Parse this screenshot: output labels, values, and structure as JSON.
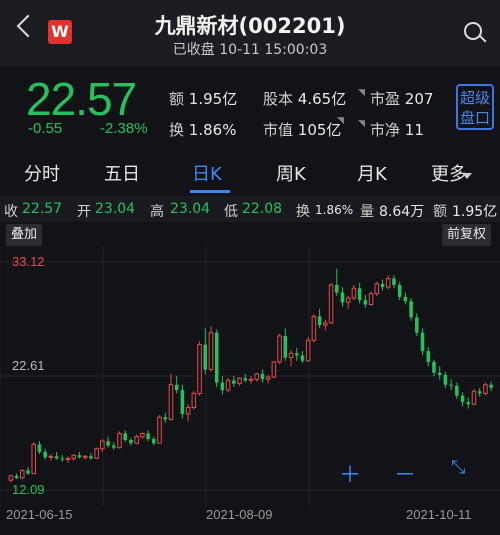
{
  "header": {
    "logo_text": "W",
    "title": "九鼎新材(002201)",
    "status": "已收盘 10-11 15:00:03",
    "back_icon": "chevron-left-icon",
    "search_icon": "search-icon"
  },
  "quote": {
    "price": "22.57",
    "change": "-0.55",
    "change_pct": "-2.38%",
    "amount_label": "额",
    "amount": "1.95亿",
    "turnover_label": "换",
    "turnover": "1.86%",
    "shares_label": "股本",
    "shares": "4.65亿",
    "mktcap_label": "市值",
    "mktcap": "105亿",
    "pe_label": "市盈",
    "pe": "207",
    "pb_label": "市净",
    "pb": "11",
    "super_btn_line1": "超级",
    "super_btn_line2": "盘口"
  },
  "tabs": [
    "分时",
    "五日",
    "日K",
    "周K",
    "月K",
    "更多"
  ],
  "active_tab": "日K",
  "ohlc": {
    "close_label": "收",
    "close": "22.57",
    "open_label": "开",
    "open": "23.04",
    "high_label": "高",
    "high": "23.04",
    "low_label": "低",
    "low": "22.08",
    "turn_label": "换",
    "turn": "1.86%",
    "vol_label": "量",
    "vol": "8.64万",
    "amt_label": "额",
    "amt": "1.95亿"
  },
  "chart_buttons": {
    "overlay": "叠加",
    "adjust": "前复权"
  },
  "zoom_icons": [
    "zoom-in-icon",
    "zoom-out-icon",
    "fullscreen-icon"
  ],
  "colors": {
    "up": "#e74a4a",
    "down": "#26c15e",
    "accent": "#3f87f5",
    "background": "#121317"
  },
  "chart_data": {
    "type": "candlestick",
    "y_max_label": "33.12",
    "y_mid_label": "22.61",
    "y_min_label": "12.09",
    "ylim": [
      12.09,
      33.12
    ],
    "x_labels": [
      "2021-06-15",
      "2021-08-09",
      "2021-10-11"
    ],
    "ohlc": [
      [
        13.0,
        13.5,
        12.8,
        13.4
      ],
      [
        13.4,
        13.6,
        13.1,
        13.2
      ],
      [
        13.2,
        14.0,
        13.1,
        13.9
      ],
      [
        13.9,
        14.2,
        13.5,
        13.6
      ],
      [
        13.6,
        16.5,
        13.6,
        16.3
      ],
      [
        16.3,
        16.6,
        15.4,
        15.6
      ],
      [
        15.6,
        15.9,
        14.9,
        15.1
      ],
      [
        15.1,
        15.4,
        14.8,
        15.2
      ],
      [
        15.2,
        15.6,
        14.9,
        15.0
      ],
      [
        15.0,
        15.3,
        14.7,
        14.9
      ],
      [
        14.9,
        15.2,
        14.6,
        15.0
      ],
      [
        15.0,
        15.4,
        14.8,
        15.3
      ],
      [
        15.3,
        15.6,
        15.0,
        15.1
      ],
      [
        15.1,
        15.3,
        14.9,
        15.2
      ],
      [
        15.2,
        15.5,
        14.9,
        15.0
      ],
      [
        15.0,
        16.0,
        15.0,
        15.9
      ],
      [
        15.9,
        16.8,
        15.6,
        16.6
      ],
      [
        16.6,
        17.0,
        16.0,
        16.2
      ],
      [
        16.2,
        16.5,
        15.8,
        16.0
      ],
      [
        16.0,
        17.5,
        15.9,
        17.3
      ],
      [
        17.3,
        17.6,
        16.5,
        16.7
      ],
      [
        16.7,
        16.9,
        16.2,
        16.4
      ],
      [
        16.4,
        17.2,
        16.3,
        17.0
      ],
      [
        17.0,
        17.4,
        16.8,
        17.3
      ],
      [
        17.3,
        17.6,
        16.6,
        16.8
      ],
      [
        16.8,
        17.0,
        16.2,
        16.4
      ],
      [
        16.4,
        19.0,
        16.4,
        18.8
      ],
      [
        18.8,
        19.2,
        18.3,
        18.6
      ],
      [
        18.6,
        22.8,
        18.5,
        21.8
      ],
      [
        21.8,
        22.6,
        21.0,
        21.3
      ],
      [
        21.3,
        21.8,
        18.7,
        19.1
      ],
      [
        19.1,
        20.0,
        18.4,
        19.7
      ],
      [
        19.7,
        21.2,
        19.5,
        21.0
      ],
      [
        21.0,
        25.8,
        20.8,
        25.5
      ],
      [
        25.5,
        27.0,
        22.8,
        23.2
      ],
      [
        23.2,
        27.2,
        23.0,
        26.6
      ],
      [
        26.6,
        26.9,
        21.6,
        22.0
      ],
      [
        22.0,
        22.6,
        20.9,
        21.3
      ],
      [
        21.3,
        22.4,
        21.1,
        22.2
      ],
      [
        22.2,
        22.6,
        21.6,
        21.9
      ],
      [
        21.9,
        22.5,
        21.7,
        22.4
      ],
      [
        22.4,
        22.8,
        22.0,
        22.2
      ],
      [
        22.2,
        22.6,
        21.9,
        22.3
      ],
      [
        22.3,
        22.9,
        22.1,
        22.8
      ],
      [
        22.8,
        23.2,
        22.0,
        22.3
      ],
      [
        22.3,
        22.7,
        21.9,
        22.5
      ],
      [
        22.5,
        24.0,
        22.4,
        23.9
      ],
      [
        23.9,
        26.5,
        23.7,
        26.3
      ],
      [
        26.3,
        27.0,
        24.0,
        24.3
      ],
      [
        24.3,
        25.0,
        23.5,
        24.7
      ],
      [
        24.7,
        25.2,
        24.0,
        24.5
      ],
      [
        24.5,
        24.9,
        23.8,
        24.0
      ],
      [
        24.0,
        26.2,
        23.9,
        25.9
      ],
      [
        25.9,
        28.3,
        25.7,
        28.1
      ],
      [
        28.1,
        28.8,
        27.0,
        27.3
      ],
      [
        27.3,
        27.8,
        26.8,
        27.5
      ],
      [
        27.5,
        31.2,
        27.4,
        31.0
      ],
      [
        31.0,
        32.5,
        30.0,
        30.3
      ],
      [
        30.3,
        30.8,
        29.0,
        29.4
      ],
      [
        29.4,
        30.0,
        28.8,
        29.8
      ],
      [
        29.8,
        31.0,
        29.6,
        30.7
      ],
      [
        30.7,
        31.2,
        29.3,
        29.6
      ],
      [
        29.6,
        30.1,
        28.9,
        29.2
      ],
      [
        29.2,
        30.4,
        29.1,
        30.2
      ],
      [
        30.2,
        31.3,
        30.0,
        31.1
      ],
      [
        31.1,
        31.5,
        30.5,
        30.8
      ],
      [
        30.8,
        31.9,
        30.6,
        31.6
      ],
      [
        31.6,
        31.9,
        30.7,
        31.0
      ],
      [
        31.0,
        31.3,
        29.6,
        29.9
      ],
      [
        29.9,
        30.3,
        29.2,
        29.5
      ],
      [
        29.5,
        29.8,
        27.7,
        28.0
      ],
      [
        28.0,
        28.4,
        26.3,
        26.6
      ],
      [
        26.6,
        27.0,
        24.5,
        24.9
      ],
      [
        24.9,
        25.3,
        23.5,
        23.9
      ],
      [
        23.9,
        24.1,
        22.6,
        22.9
      ],
      [
        22.9,
        23.5,
        22.3,
        22.7
      ],
      [
        22.7,
        23.0,
        21.5,
        21.8
      ],
      [
        21.8,
        22.3,
        21.3,
        21.7
      ],
      [
        21.7,
        22.0,
        20.5,
        20.8
      ],
      [
        20.8,
        21.1,
        19.8,
        20.2
      ],
      [
        20.2,
        20.6,
        19.6,
        20.0
      ],
      [
        20.0,
        21.4,
        19.9,
        21.2
      ],
      [
        21.2,
        21.5,
        20.7,
        21.0
      ],
      [
        21.0,
        22.0,
        20.8,
        21.8
      ],
      [
        21.8,
        22.1,
        21.2,
        21.5
      ]
    ]
  }
}
